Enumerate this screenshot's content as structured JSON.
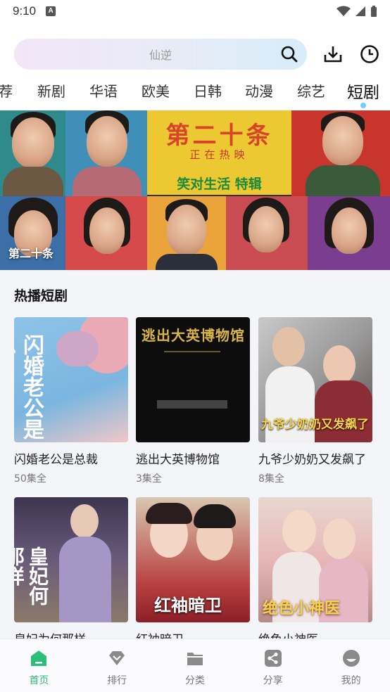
{
  "status": {
    "time": "9:10",
    "badge": "A"
  },
  "search": {
    "placeholder": "仙逆"
  },
  "tabs": [
    {
      "label": "荐"
    },
    {
      "label": "新剧"
    },
    {
      "label": "华语"
    },
    {
      "label": "欧美"
    },
    {
      "label": "日韩"
    },
    {
      "label": "动漫"
    },
    {
      "label": "综艺"
    },
    {
      "label": "短剧",
      "active": true
    }
  ],
  "banner": {
    "caption": "第二十条",
    "poster_title": "第二十条",
    "poster_sub": "正在热映",
    "poster_slogan": "笑对生活 特辑"
  },
  "section": {
    "title": "热播短剧"
  },
  "dramas": [
    {
      "title": "闪婚老公是总裁",
      "eps": "50集全",
      "poster_text": "闪婚老公是总"
    },
    {
      "title": "逃出大英博物馆",
      "eps": "3集全",
      "poster_text": "逃出大英博物馆"
    },
    {
      "title": "九爷少奶奶又发飙了",
      "eps": "8集全",
      "poster_text": "九爷少奶奶又发飙了"
    },
    {
      "title": "皇妃为何那样",
      "eps": "",
      "poster_text": "皇妃何那样"
    },
    {
      "title": "红袖暗卫",
      "eps": "",
      "poster_text": "红袖暗卫"
    },
    {
      "title": "绝色小神医",
      "eps": "",
      "poster_text": "绝色小神医"
    }
  ],
  "nav": [
    {
      "label": "首页",
      "icon": "home-icon",
      "active": true
    },
    {
      "label": "排行",
      "icon": "diamond-icon"
    },
    {
      "label": "分类",
      "icon": "folder-icon"
    },
    {
      "label": "分享",
      "icon": "share-icon"
    },
    {
      "label": "我的",
      "icon": "profile-icon"
    }
  ],
  "colors": {
    "accent": "#2bbf7a",
    "tab_dot": "#6cd2f2"
  }
}
